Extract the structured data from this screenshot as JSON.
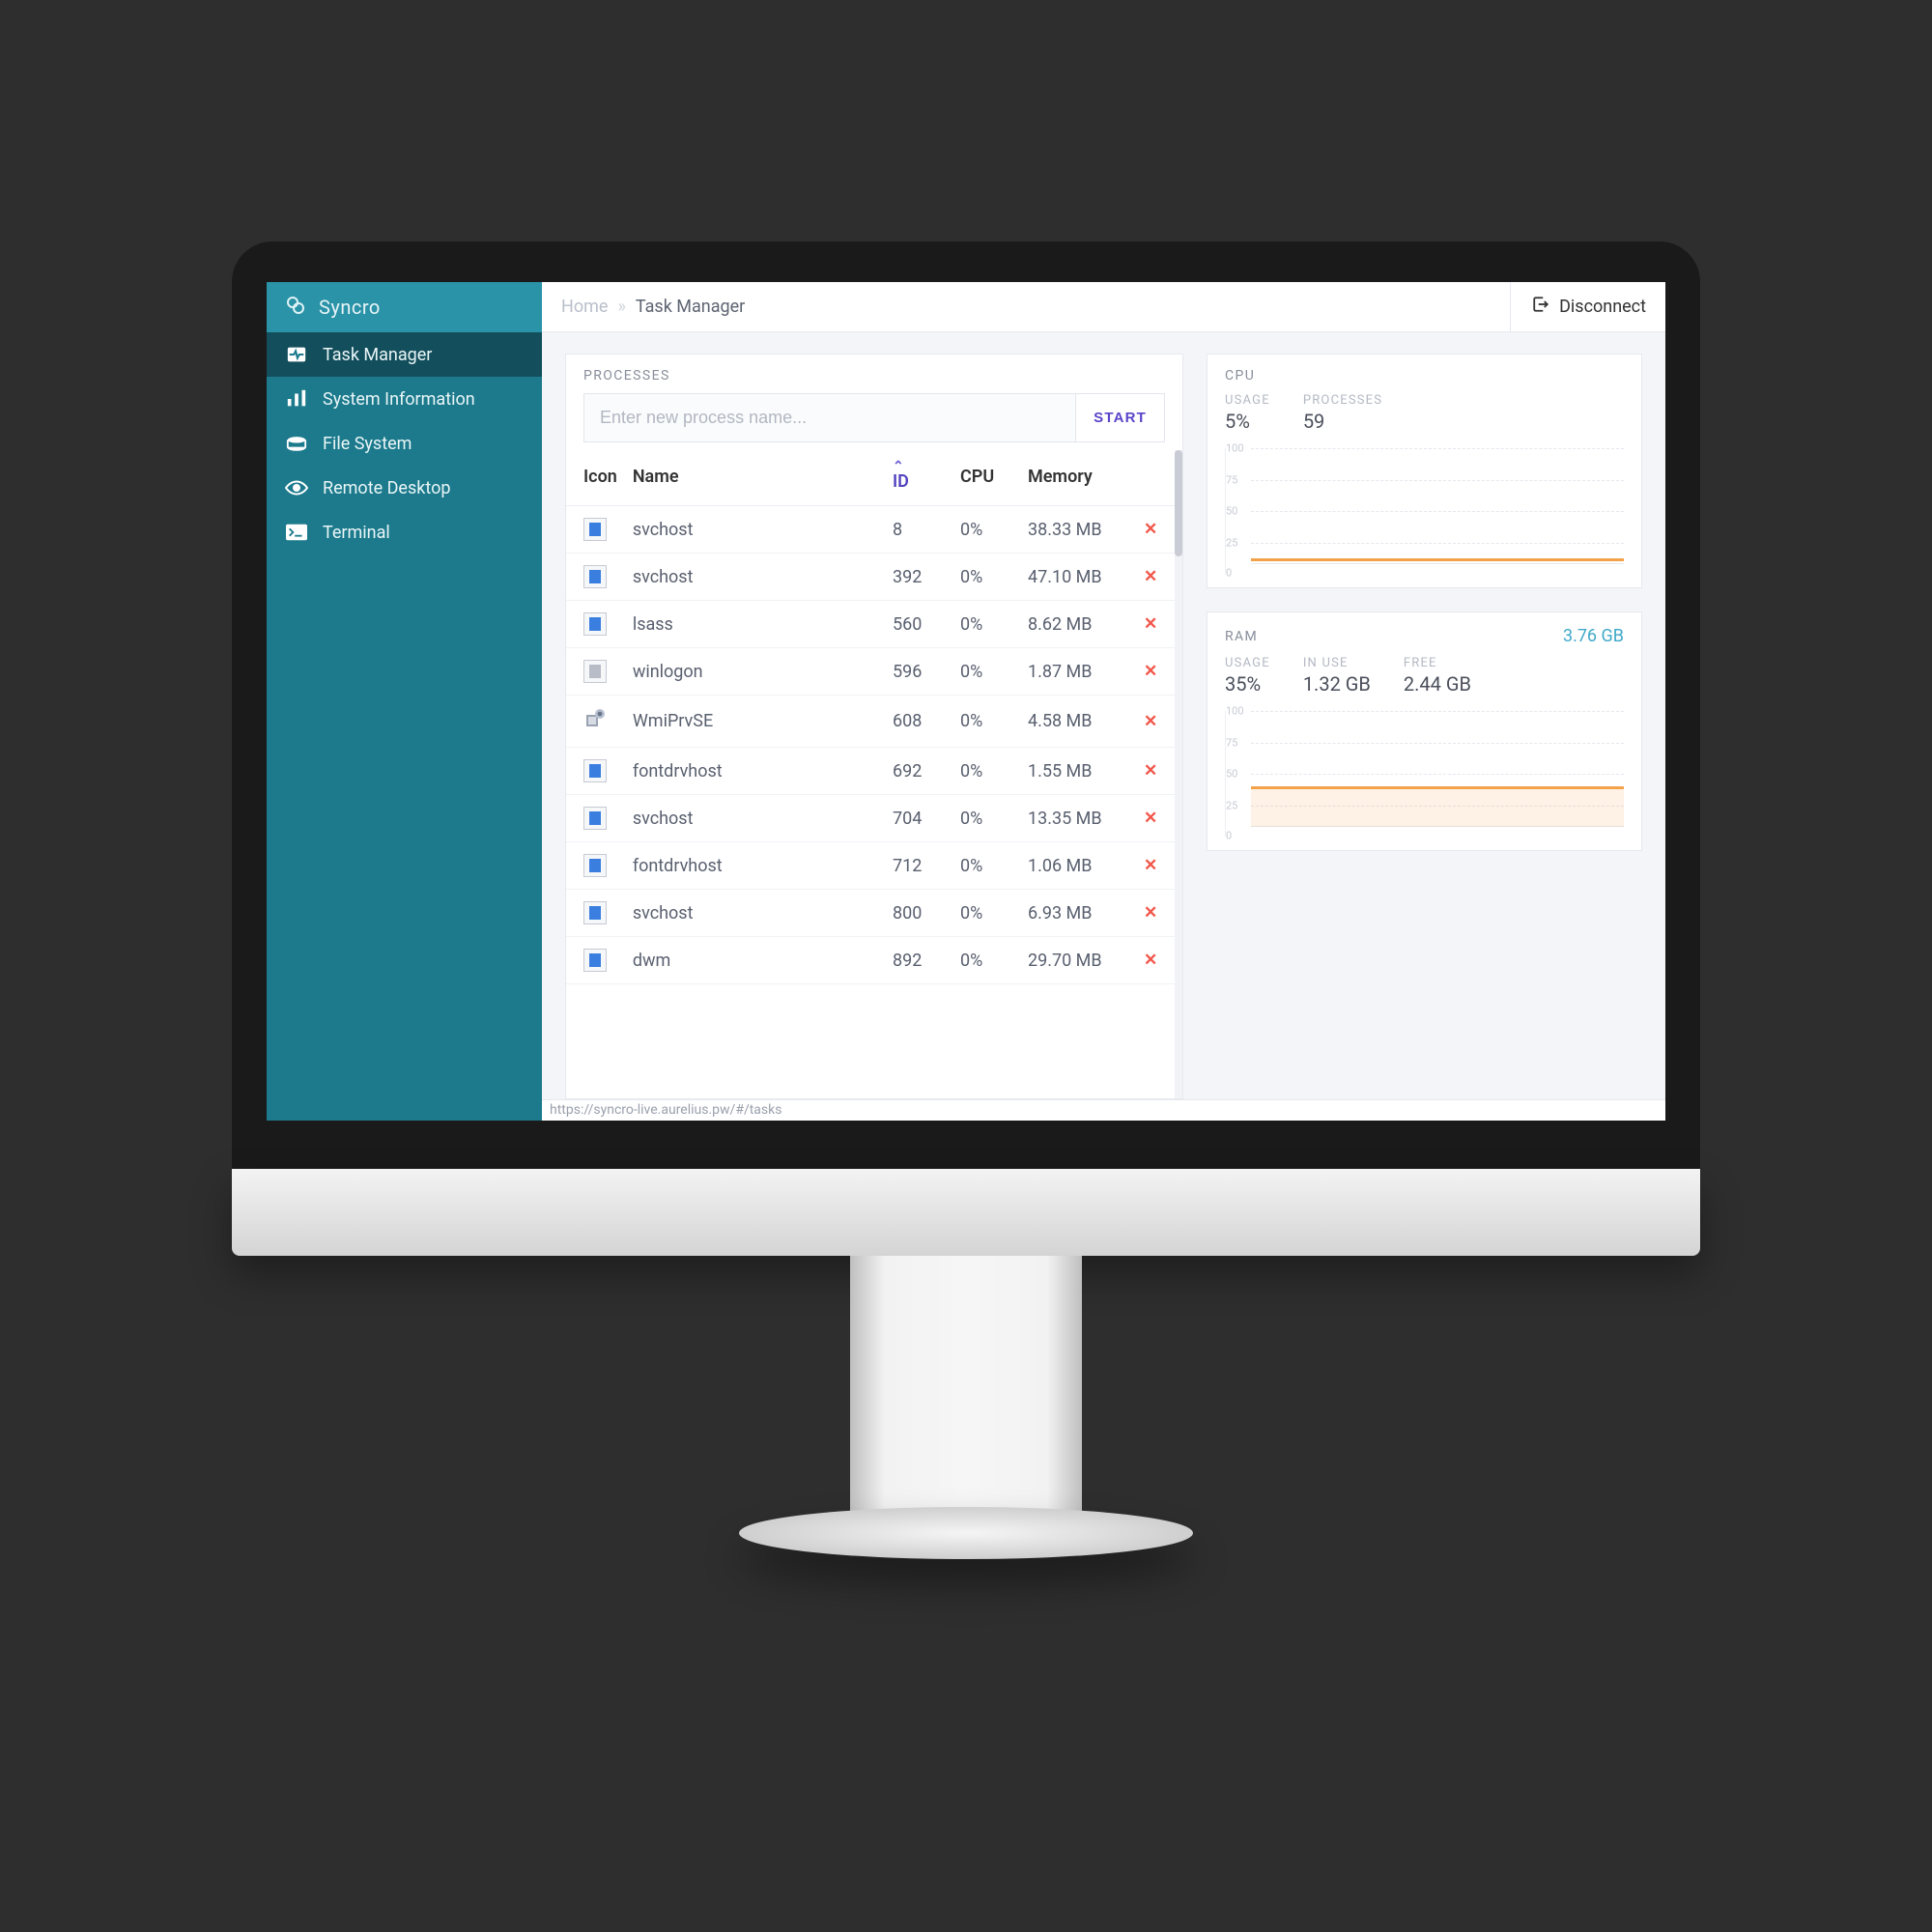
{
  "brand": "Syncro",
  "sidebar": {
    "items": [
      {
        "label": "Task Manager",
        "icon": "activity-icon",
        "active": true
      },
      {
        "label": "System Information",
        "icon": "bars-icon"
      },
      {
        "label": "File System",
        "icon": "drive-icon"
      },
      {
        "label": "Remote Desktop",
        "icon": "eye-icon"
      },
      {
        "label": "Terminal",
        "icon": "terminal-icon"
      }
    ]
  },
  "breadcrumb": {
    "home": "Home",
    "current": "Task Manager"
  },
  "disconnect_label": "Disconnect",
  "processes": {
    "title": "PROCESSES",
    "input_placeholder": "Enter new process name...",
    "start_label": "START",
    "columns": {
      "icon": "Icon",
      "name": "Name",
      "id": "ID",
      "cpu": "CPU",
      "memory": "Memory"
    },
    "sort_column": "id",
    "rows": [
      {
        "name": "svchost",
        "id": "8",
        "cpu": "0%",
        "memory": "38.33 MB",
        "icon": "blue"
      },
      {
        "name": "svchost",
        "id": "392",
        "cpu": "0%",
        "memory": "47.10 MB",
        "icon": "blue"
      },
      {
        "name": "lsass",
        "id": "560",
        "cpu": "0%",
        "memory": "8.62 MB",
        "icon": "blue"
      },
      {
        "name": "winlogon",
        "id": "596",
        "cpu": "0%",
        "memory": "1.87 MB",
        "icon": "grey"
      },
      {
        "name": "WmiPrvSE",
        "id": "608",
        "cpu": "0%",
        "memory": "4.58 MB",
        "icon": "wmi"
      },
      {
        "name": "fontdrvhost",
        "id": "692",
        "cpu": "0%",
        "memory": "1.55 MB",
        "icon": "blue"
      },
      {
        "name": "svchost",
        "id": "704",
        "cpu": "0%",
        "memory": "13.35 MB",
        "icon": "blue"
      },
      {
        "name": "fontdrvhost",
        "id": "712",
        "cpu": "0%",
        "memory": "1.06 MB",
        "icon": "blue"
      },
      {
        "name": "svchost",
        "id": "800",
        "cpu": "0%",
        "memory": "6.93 MB",
        "icon": "blue"
      },
      {
        "name": "dwm",
        "id": "892",
        "cpu": "0%",
        "memory": "29.70 MB",
        "icon": "blue"
      }
    ]
  },
  "cpu": {
    "title": "CPU",
    "stats": [
      {
        "label": "USAGE",
        "value": "5%"
      },
      {
        "label": "PROCESSES",
        "value": "59"
      }
    ],
    "yticks": [
      "100",
      "75",
      "50",
      "25",
      "0"
    ]
  },
  "ram": {
    "title": "RAM",
    "total": "3.76 GB",
    "stats": [
      {
        "label": "USAGE",
        "value": "35%"
      },
      {
        "label": "IN USE",
        "value": "1.32 GB"
      },
      {
        "label": "FREE",
        "value": "2.44 GB"
      }
    ],
    "yticks": [
      "100",
      "75",
      "50",
      "25",
      "0"
    ]
  },
  "statusbar": "https://syncro-live.aurelius.pw/#/tasks",
  "chart_data": [
    {
      "type": "line",
      "title": "CPU",
      "ylabel": "%",
      "ylim": [
        0,
        100
      ],
      "yticks": [
        0,
        25,
        50,
        75,
        100
      ],
      "series": [
        {
          "name": "CPU usage",
          "values": [
            5,
            5,
            5,
            5,
            5,
            5,
            5,
            5,
            5,
            5,
            5,
            5,
            5,
            5,
            5,
            5,
            5,
            5,
            5,
            5
          ]
        }
      ]
    },
    {
      "type": "area",
      "title": "RAM",
      "ylabel": "%",
      "ylim": [
        0,
        100
      ],
      "yticks": [
        0,
        25,
        50,
        75,
        100
      ],
      "series": [
        {
          "name": "RAM usage",
          "values": [
            35,
            35,
            35,
            35,
            35,
            35,
            35,
            35,
            35,
            35,
            35,
            35,
            35,
            35,
            35,
            35,
            35,
            35,
            35,
            35
          ]
        }
      ]
    }
  ],
  "colors": {
    "sidebar": "#1c7a8c",
    "sidebar_active": "#124e5b",
    "accent": "#5b44c9",
    "chart_line": "#f4a24a",
    "danger": "#f2564a",
    "link": "#3fa9c9"
  }
}
